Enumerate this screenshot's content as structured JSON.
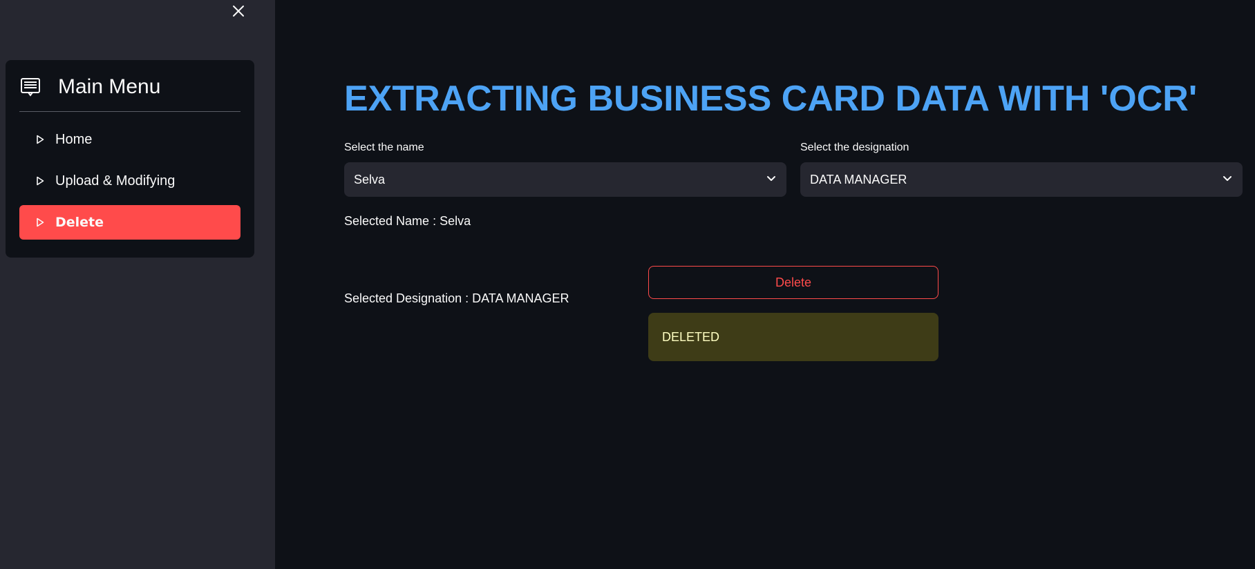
{
  "sidebar": {
    "menu_title": "Main Menu",
    "items": [
      {
        "label": "Home",
        "active": false
      },
      {
        "label": "Upload & Modifying",
        "active": false
      },
      {
        "label": "Delete",
        "active": true
      }
    ]
  },
  "main": {
    "title": "EXTRACTING BUSINESS CARD DATA WITH 'OCR'",
    "name_select": {
      "label": "Select the name",
      "value": "Selva"
    },
    "designation_select": {
      "label": "Select the designation",
      "value": "DATA MANAGER"
    },
    "selected_name_text": "Selected Name : Selva",
    "selected_designation_text": "Selected Designation : DATA MANAGER",
    "delete_button_label": "Delete",
    "alert_text": "DELETED"
  },
  "colors": {
    "accent": "#ff4b4b",
    "title": "#4da3f5",
    "background": "#0e1117",
    "sidebar": "#262730",
    "alert_bg": "#3e3c17",
    "alert_text": "#ffffc2"
  }
}
